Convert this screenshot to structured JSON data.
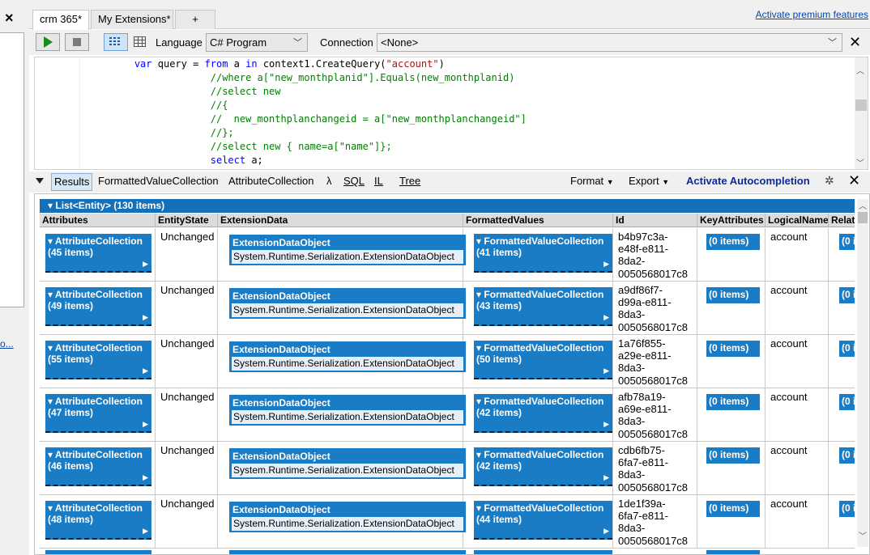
{
  "window": {
    "close_icon": "×",
    "left_link": "o..."
  },
  "tabs": [
    {
      "label": "crm 365*",
      "active": true
    },
    {
      "label": "My Extensions*",
      "active": false
    },
    {
      "label": "+",
      "active": false
    }
  ],
  "premium_link": "Activate premium features",
  "toolbar": {
    "language_label": "Language",
    "language_value": "C# Program",
    "connection_label": "Connection",
    "connection_value": "<None>"
  },
  "code_lines": [
    {
      "indent": "                 ",
      "parts": [
        {
          "t": "var",
          "c": "kw"
        },
        {
          "t": " query = ",
          "c": ""
        },
        {
          "t": "from",
          "c": "kw"
        },
        {
          "t": " a ",
          "c": ""
        },
        {
          "t": "in",
          "c": "kw"
        },
        {
          "t": " context1.CreateQuery(",
          "c": ""
        },
        {
          "t": "\"account\"",
          "c": "str"
        },
        {
          "t": ")",
          "c": ""
        }
      ]
    },
    {
      "indent": "                              ",
      "parts": [
        {
          "t": "//where a[\"new_monthplanid\"].Equals(new_monthplanid)",
          "c": "cm"
        }
      ]
    },
    {
      "indent": "                              ",
      "parts": [
        {
          "t": "//select new",
          "c": "cm"
        }
      ]
    },
    {
      "indent": "                              ",
      "parts": [
        {
          "t": "//{",
          "c": "cm"
        }
      ]
    },
    {
      "indent": "                              ",
      "parts": [
        {
          "t": "//  new_monthplanchangeid = a[\"new_monthplanchangeid\"]",
          "c": "cm"
        }
      ]
    },
    {
      "indent": "                              ",
      "parts": [
        {
          "t": "//};",
          "c": "cm"
        }
      ]
    },
    {
      "indent": "                              ",
      "parts": [
        {
          "t": "//select new { name=a[\"name\"]};",
          "c": "cm"
        }
      ]
    },
    {
      "indent": "                              ",
      "parts": [
        {
          "t": "select",
          "c": "kw"
        },
        {
          "t": " a;",
          "c": ""
        }
      ]
    }
  ],
  "results_toolbar": {
    "tabs": [
      "Results",
      "FormattedValueCollection",
      "AttributeCollection",
      "λ",
      "SQL",
      "IL",
      "Tree"
    ],
    "format": "Format",
    "export": "Export",
    "autocompletion": "Activate Autocompletion"
  },
  "results": {
    "list_header": "List<Entity> (130 items)",
    "columns": [
      "Attributes",
      "EntityState",
      "ExtensionData",
      "FormattedValues",
      "Id",
      "KeyAttributes",
      "LogicalName",
      "Relat"
    ],
    "ext_title": "ExtensionDataObject",
    "ext_value": "System.Runtime.Serialization.ExtensionDataObject",
    "ac_title": "AttributeCollection",
    "fv_title": "FormattedValueCollection",
    "rows": [
      {
        "attributes": "(45 items)",
        "state": "Unchanged",
        "formatted": "(41 items)",
        "id": "b4b97c3a-\ne48f-e811-\n8da2-\n0050568017c8",
        "key": "(0 items)",
        "logical": "account",
        "rel": "(0 i"
      },
      {
        "attributes": "(49 items)",
        "state": "Unchanged",
        "formatted": "(43 items)",
        "id": "a9df86f7-\nd99a-e811-\n8da3-\n0050568017c8",
        "key": "(0 items)",
        "logical": "account",
        "rel": "(0 i"
      },
      {
        "attributes": "(55 items)",
        "state": "Unchanged",
        "formatted": "(50 items)",
        "id": "1a76f855-\na29e-e811-\n8da3-\n0050568017c8",
        "key": "(0 items)",
        "logical": "account",
        "rel": "(0 i"
      },
      {
        "attributes": "(47 items)",
        "state": "Unchanged",
        "formatted": "(42 items)",
        "id": "afb78a19-\na69e-e811-\n8da3-\n0050568017c8",
        "key": "(0 items)",
        "logical": "account",
        "rel": "(0 i"
      },
      {
        "attributes": "(46 items)",
        "state": "Unchanged",
        "formatted": "(42 items)",
        "id": "cdb6fb75-\n6fa7-e811-\n8da3-\n0050568017c8",
        "key": "(0 items)",
        "logical": "account",
        "rel": "(0 i"
      },
      {
        "attributes": "(48 items)",
        "state": "Unchanged",
        "formatted": "(44 items)",
        "id": "1de1f39a-\n6fa7-e811-\n8da3-\n0050568017c8",
        "key": "(0 items)",
        "logical": "account",
        "rel": "(0 i"
      }
    ]
  }
}
